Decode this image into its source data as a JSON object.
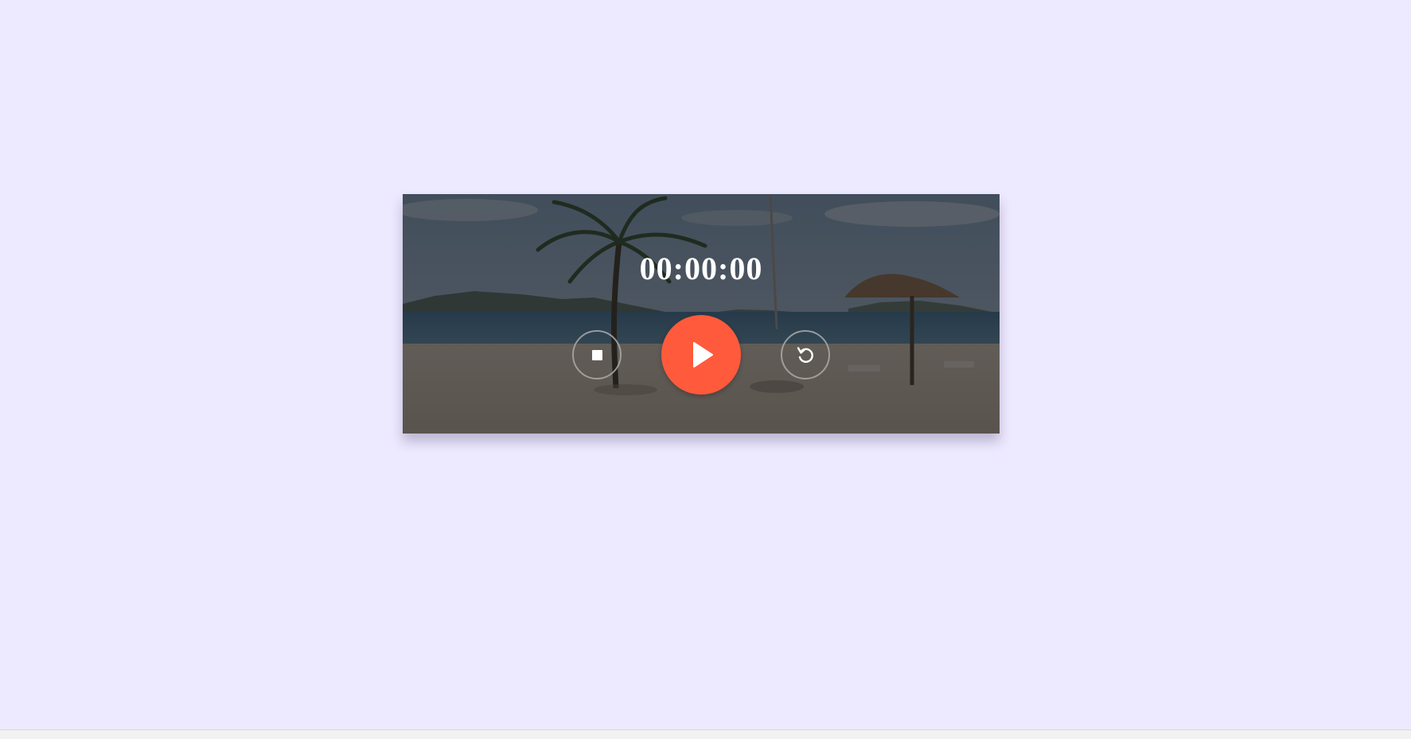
{
  "colors": {
    "page_background": "#ede9ff",
    "accent": "#ff5a3b",
    "overlay": "#141418",
    "text": "#ffffff"
  },
  "timer": {
    "display": "00:00:00"
  },
  "controls": {
    "stop_icon": "stop-icon",
    "play_icon": "play-icon",
    "reset_icon": "reset-icon"
  }
}
